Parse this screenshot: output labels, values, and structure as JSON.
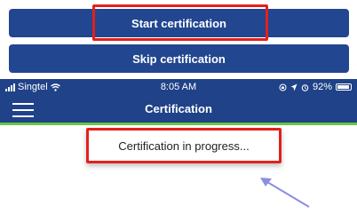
{
  "buttons": {
    "start_label": "Start certification",
    "skip_label": "Skip certification"
  },
  "status_bar": {
    "carrier": "Singtel",
    "time": "8:05 AM",
    "battery": "92%",
    "battery_level": 0.92
  },
  "nav": {
    "title": "Certification"
  },
  "content": {
    "progress_message": "Certification in progress..."
  },
  "colors": {
    "primary": "#22468f",
    "navbar": "#1f4288",
    "accent_green": "#69c644",
    "highlight_red": "#e3201b",
    "arrow": "#8a8ee0"
  }
}
